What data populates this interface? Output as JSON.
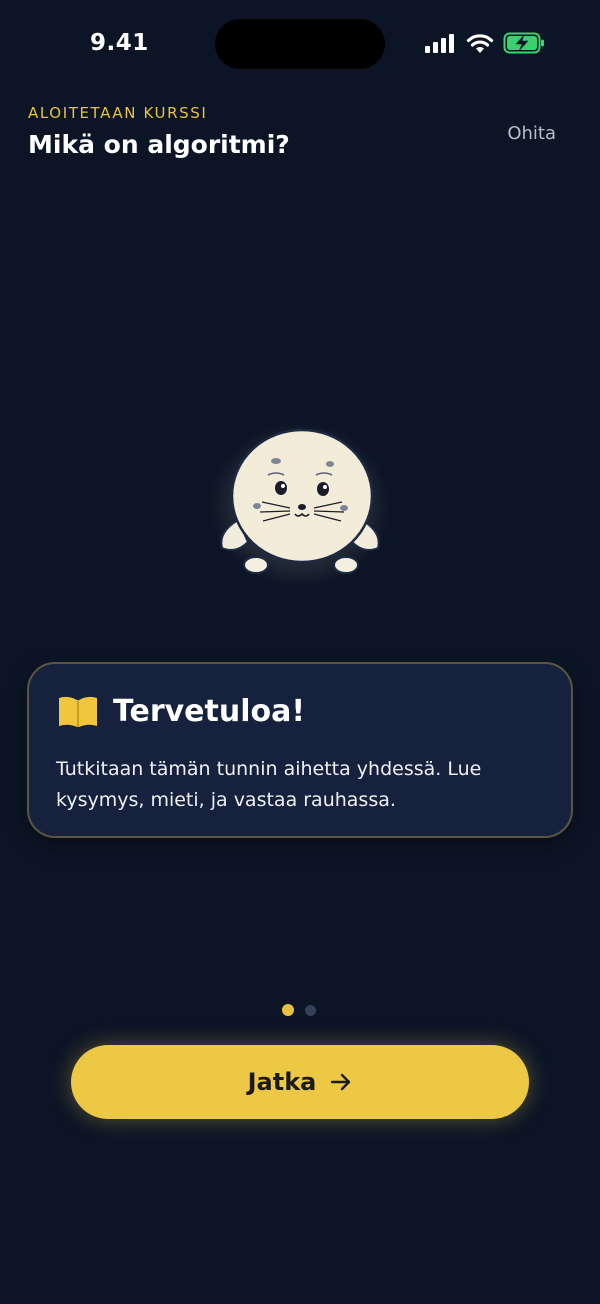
{
  "status_bar": {
    "time": "9.41"
  },
  "header": {
    "eyebrow": "ALOITETAAN KURSSI",
    "title": "Mikä on algoritmi?",
    "skip_label": "Ohita"
  },
  "card": {
    "icon": "open-book-icon",
    "title": "Tervetuloa!",
    "body": "Tutkitaan tämän tunnin aihetta yhdessä. Lue kysymys, mieti, ja vastaa rauhassa."
  },
  "pagination": {
    "total": 2,
    "current": 1
  },
  "cta": {
    "label": "Jatka",
    "icon": "arrow-right-icon"
  },
  "colors": {
    "background": "#0c1526",
    "accent": "#e8c23d",
    "card_bg": "#16213d",
    "card_border": "#5c5640",
    "battery": "#3bd16f"
  }
}
